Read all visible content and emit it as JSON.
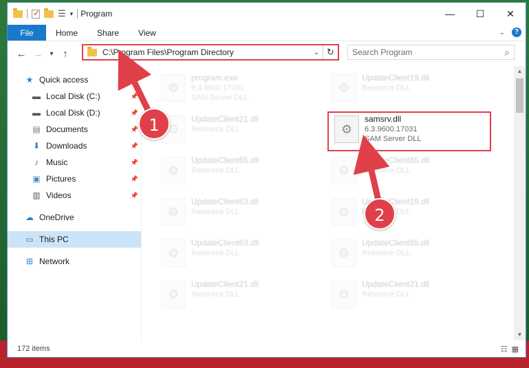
{
  "titlebar": {
    "title": "Program",
    "minimize": "—",
    "maximize": "☐",
    "close": "✕"
  },
  "ribbon": {
    "tabs": [
      {
        "label": "File"
      },
      {
        "label": "Home"
      },
      {
        "label": "Share"
      },
      {
        "label": "View"
      }
    ]
  },
  "nav": {
    "back": "←",
    "forward": "→",
    "recent": "▾",
    "up": "↑",
    "address": "C:\\Program Files\\Program Directory",
    "refresh": "↻",
    "search_placeholder": "Search Program",
    "search_icon": "⌕"
  },
  "sidebar": {
    "items": [
      {
        "label": "Quick access",
        "icon": "star-icon"
      },
      {
        "label": "Local Disk (C:)",
        "icon": "drive-icon"
      },
      {
        "label": "Local Disk (D:)",
        "icon": "drive-icon"
      },
      {
        "label": "Documents",
        "icon": "documents-icon"
      },
      {
        "label": "Downloads",
        "icon": "download-icon"
      },
      {
        "label": "Music",
        "icon": "music-icon"
      },
      {
        "label": "Pictures",
        "icon": "pictures-icon"
      },
      {
        "label": "Videos",
        "icon": "videos-icon"
      },
      {
        "label": "OneDrive",
        "icon": "cloud-icon"
      },
      {
        "label": "This PC",
        "icon": "computer-icon"
      },
      {
        "label": "Network",
        "icon": "network-icon"
      }
    ]
  },
  "files": [
    {
      "name": "program.exe",
      "version": "6.3.9600.17031",
      "desc": "SAM Server DLL"
    },
    {
      "name": "UpdateClient19.dll",
      "desc": "Resource DLL"
    },
    {
      "name": "UpdateClient21.dll",
      "desc": "Resource DLL"
    },
    {
      "name": "samsrv.dll",
      "version": "6.3.9600.17031",
      "desc": "SAM Server DLL"
    },
    {
      "name": "UpdateClient65.dll",
      "desc": "Resource DLL"
    },
    {
      "name": "UpdateClient65.dll",
      "desc": "Resource DLL"
    },
    {
      "name": "UpdateClient63.dll",
      "desc": "Resource DLL"
    },
    {
      "name": "UpdateClient19.dll",
      "desc": "Resource DLL"
    },
    {
      "name": "UpdateClient63.dll",
      "desc": "Resource DLL"
    },
    {
      "name": "UpdateClient65.dll",
      "desc": "Resource DLL"
    },
    {
      "name": "UpdateClient21.dll",
      "desc": "Resource DLL"
    },
    {
      "name": "UpdateClient21.dll",
      "desc": "Resource DLL"
    }
  ],
  "status": {
    "items": "172 items"
  },
  "annotations": {
    "step1": "1",
    "step2": "2"
  },
  "colors": {
    "accent": "#1979ca",
    "highlight": "#e0404a",
    "selected": "#cce4f7"
  }
}
